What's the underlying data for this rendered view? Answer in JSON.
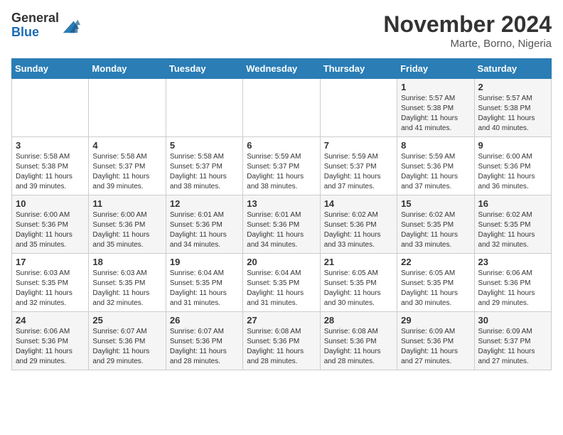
{
  "logo": {
    "general": "General",
    "blue": "Blue"
  },
  "header": {
    "month": "November 2024",
    "location": "Marte, Borno, Nigeria"
  },
  "days_of_week": [
    "Sunday",
    "Monday",
    "Tuesday",
    "Wednesday",
    "Thursday",
    "Friday",
    "Saturday"
  ],
  "weeks": [
    [
      {
        "day": "",
        "info": ""
      },
      {
        "day": "",
        "info": ""
      },
      {
        "day": "",
        "info": ""
      },
      {
        "day": "",
        "info": ""
      },
      {
        "day": "",
        "info": ""
      },
      {
        "day": "1",
        "info": "Sunrise: 5:57 AM\nSunset: 5:38 PM\nDaylight: 11 hours and 41 minutes."
      },
      {
        "day": "2",
        "info": "Sunrise: 5:57 AM\nSunset: 5:38 PM\nDaylight: 11 hours and 40 minutes."
      }
    ],
    [
      {
        "day": "3",
        "info": "Sunrise: 5:58 AM\nSunset: 5:38 PM\nDaylight: 11 hours and 39 minutes."
      },
      {
        "day": "4",
        "info": "Sunrise: 5:58 AM\nSunset: 5:37 PM\nDaylight: 11 hours and 39 minutes."
      },
      {
        "day": "5",
        "info": "Sunrise: 5:58 AM\nSunset: 5:37 PM\nDaylight: 11 hours and 38 minutes."
      },
      {
        "day": "6",
        "info": "Sunrise: 5:59 AM\nSunset: 5:37 PM\nDaylight: 11 hours and 38 minutes."
      },
      {
        "day": "7",
        "info": "Sunrise: 5:59 AM\nSunset: 5:37 PM\nDaylight: 11 hours and 37 minutes."
      },
      {
        "day": "8",
        "info": "Sunrise: 5:59 AM\nSunset: 5:36 PM\nDaylight: 11 hours and 37 minutes."
      },
      {
        "day": "9",
        "info": "Sunrise: 6:00 AM\nSunset: 5:36 PM\nDaylight: 11 hours and 36 minutes."
      }
    ],
    [
      {
        "day": "10",
        "info": "Sunrise: 6:00 AM\nSunset: 5:36 PM\nDaylight: 11 hours and 35 minutes."
      },
      {
        "day": "11",
        "info": "Sunrise: 6:00 AM\nSunset: 5:36 PM\nDaylight: 11 hours and 35 minutes."
      },
      {
        "day": "12",
        "info": "Sunrise: 6:01 AM\nSunset: 5:36 PM\nDaylight: 11 hours and 34 minutes."
      },
      {
        "day": "13",
        "info": "Sunrise: 6:01 AM\nSunset: 5:36 PM\nDaylight: 11 hours and 34 minutes."
      },
      {
        "day": "14",
        "info": "Sunrise: 6:02 AM\nSunset: 5:36 PM\nDaylight: 11 hours and 33 minutes."
      },
      {
        "day": "15",
        "info": "Sunrise: 6:02 AM\nSunset: 5:35 PM\nDaylight: 11 hours and 33 minutes."
      },
      {
        "day": "16",
        "info": "Sunrise: 6:02 AM\nSunset: 5:35 PM\nDaylight: 11 hours and 32 minutes."
      }
    ],
    [
      {
        "day": "17",
        "info": "Sunrise: 6:03 AM\nSunset: 5:35 PM\nDaylight: 11 hours and 32 minutes."
      },
      {
        "day": "18",
        "info": "Sunrise: 6:03 AM\nSunset: 5:35 PM\nDaylight: 11 hours and 32 minutes."
      },
      {
        "day": "19",
        "info": "Sunrise: 6:04 AM\nSunset: 5:35 PM\nDaylight: 11 hours and 31 minutes."
      },
      {
        "day": "20",
        "info": "Sunrise: 6:04 AM\nSunset: 5:35 PM\nDaylight: 11 hours and 31 minutes."
      },
      {
        "day": "21",
        "info": "Sunrise: 6:05 AM\nSunset: 5:35 PM\nDaylight: 11 hours and 30 minutes."
      },
      {
        "day": "22",
        "info": "Sunrise: 6:05 AM\nSunset: 5:35 PM\nDaylight: 11 hours and 30 minutes."
      },
      {
        "day": "23",
        "info": "Sunrise: 6:06 AM\nSunset: 5:36 PM\nDaylight: 11 hours and 29 minutes."
      }
    ],
    [
      {
        "day": "24",
        "info": "Sunrise: 6:06 AM\nSunset: 5:36 PM\nDaylight: 11 hours and 29 minutes."
      },
      {
        "day": "25",
        "info": "Sunrise: 6:07 AM\nSunset: 5:36 PM\nDaylight: 11 hours and 29 minutes."
      },
      {
        "day": "26",
        "info": "Sunrise: 6:07 AM\nSunset: 5:36 PM\nDaylight: 11 hours and 28 minutes."
      },
      {
        "day": "27",
        "info": "Sunrise: 6:08 AM\nSunset: 5:36 PM\nDaylight: 11 hours and 28 minutes."
      },
      {
        "day": "28",
        "info": "Sunrise: 6:08 AM\nSunset: 5:36 PM\nDaylight: 11 hours and 28 minutes."
      },
      {
        "day": "29",
        "info": "Sunrise: 6:09 AM\nSunset: 5:36 PM\nDaylight: 11 hours and 27 minutes."
      },
      {
        "day": "30",
        "info": "Sunrise: 6:09 AM\nSunset: 5:37 PM\nDaylight: 11 hours and 27 minutes."
      }
    ]
  ]
}
